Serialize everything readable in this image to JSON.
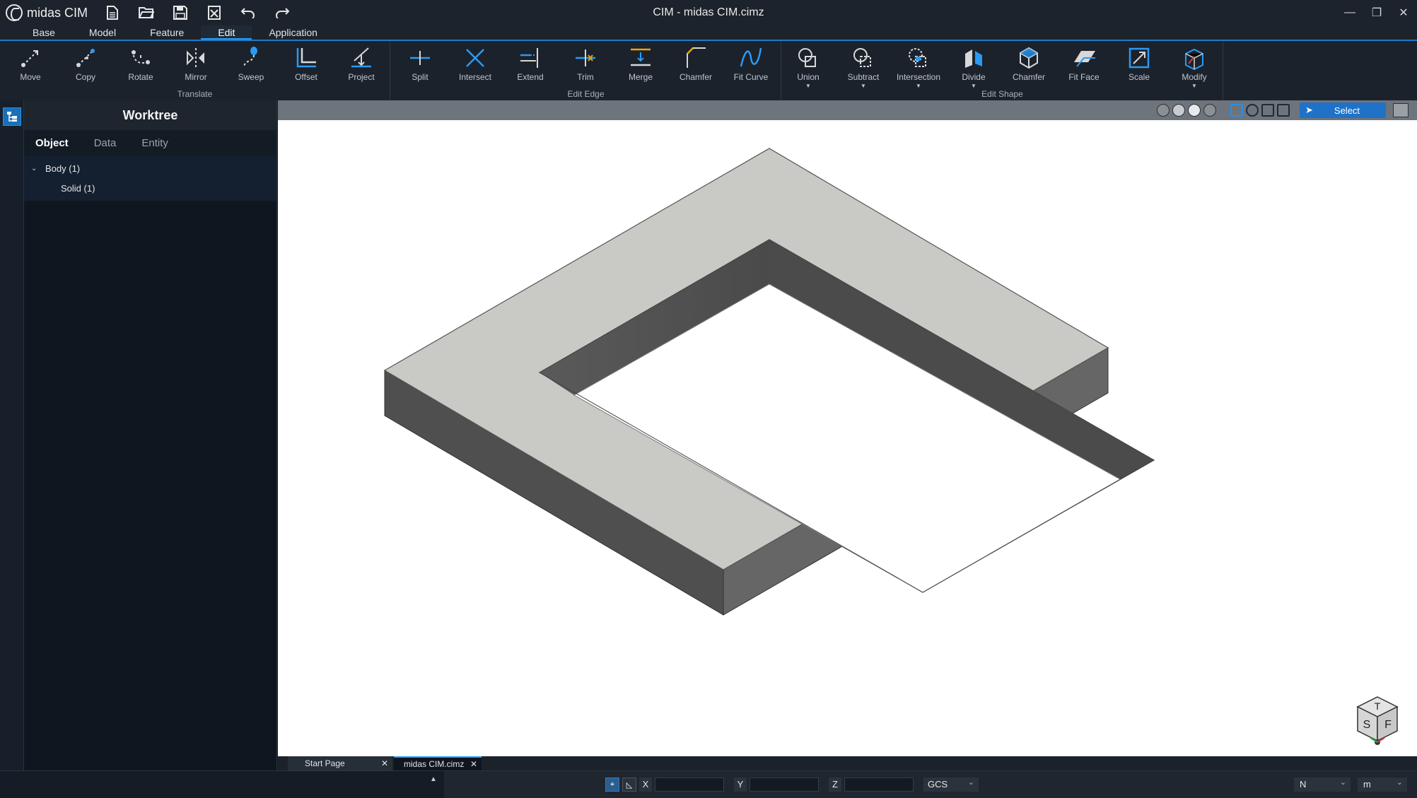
{
  "app": {
    "brand": "midas CIM",
    "window_title": "CIM - midas CIM.cimz"
  },
  "quick_access": [
    {
      "name": "new-file-icon",
      "glyph": "🗎"
    },
    {
      "name": "open-folder-icon",
      "glyph": "📂"
    },
    {
      "name": "save-icon",
      "glyph": "💾"
    },
    {
      "name": "close-file-icon",
      "glyph": "⊠"
    },
    {
      "name": "undo-icon",
      "glyph": "↶"
    },
    {
      "name": "redo-icon",
      "glyph": "↷"
    }
  ],
  "window_controls": {
    "minimize": "—",
    "restore": "❐",
    "close": "✕"
  },
  "menu": [
    "Base",
    "Model",
    "Feature",
    "Edit",
    "Application"
  ],
  "menu_active": "Edit",
  "ribbon": {
    "groups": [
      {
        "label": "Translate",
        "tools": [
          "Move",
          "Copy",
          "Rotate",
          "Mirror",
          "Sweep",
          "Offset",
          "Project"
        ]
      },
      {
        "label": "Edit Edge",
        "tools": [
          "Split",
          "Intersect",
          "Extend",
          "Trim",
          "Merge",
          "Chamfer",
          "Fit Curve"
        ]
      },
      {
        "label": "Edit Shape",
        "tools": [
          "Union",
          "Subtract",
          "Intersection",
          "Divide",
          "Chamfer",
          "Fit Face",
          "Scale",
          "Modify"
        ]
      }
    ]
  },
  "worktree": {
    "title": "Worktree",
    "tabs": [
      "Object",
      "Data",
      "Entity"
    ],
    "active_tab": "Object",
    "items": [
      {
        "label": "Body (1)",
        "level": 1,
        "expanded": true
      },
      {
        "label": "Solid (1)",
        "level": 2
      }
    ]
  },
  "viewport": {
    "select_label": "Select"
  },
  "doc_tabs": [
    {
      "label": "Start Page",
      "close": "✕",
      "active": false
    },
    {
      "label": "midas CIM.cimz",
      "close": "✕",
      "active": true
    }
  ],
  "status": {
    "axes": [
      "X",
      "Y",
      "Z"
    ],
    "x_value": "",
    "y_value": "",
    "z_value": "",
    "coordinate_system": "GCS",
    "force_unit": "N",
    "length_unit": "m"
  },
  "viewcube": {
    "top": "T",
    "left": "S",
    "right": "F"
  },
  "colors": {
    "accent": "#1f79c9",
    "top_face": "#c9c9c5",
    "side_face_dark": "#4f4f4f",
    "side_face_mid": "#666666"
  }
}
